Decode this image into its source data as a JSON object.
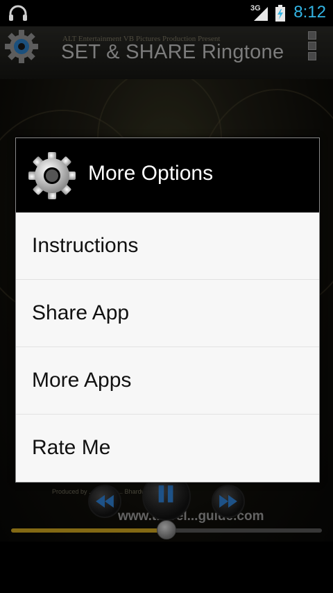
{
  "status_bar": {
    "network_type": "3G",
    "time": "8:12"
  },
  "app": {
    "title": "SET & SHARE Ringtone",
    "credits_line": "ALT Entertainment   VB Pictures Production Present"
  },
  "player": {
    "poster_credits": "Produced by ... Kapoor ... Bhardwaj",
    "site_text": "www.travel...guide.com",
    "progress": 0.5
  },
  "dialog": {
    "title": "More Options",
    "options": [
      {
        "label": "Instructions"
      },
      {
        "label": "Share App"
      },
      {
        "label": "More Apps"
      },
      {
        "label": "Rate Me"
      }
    ]
  }
}
